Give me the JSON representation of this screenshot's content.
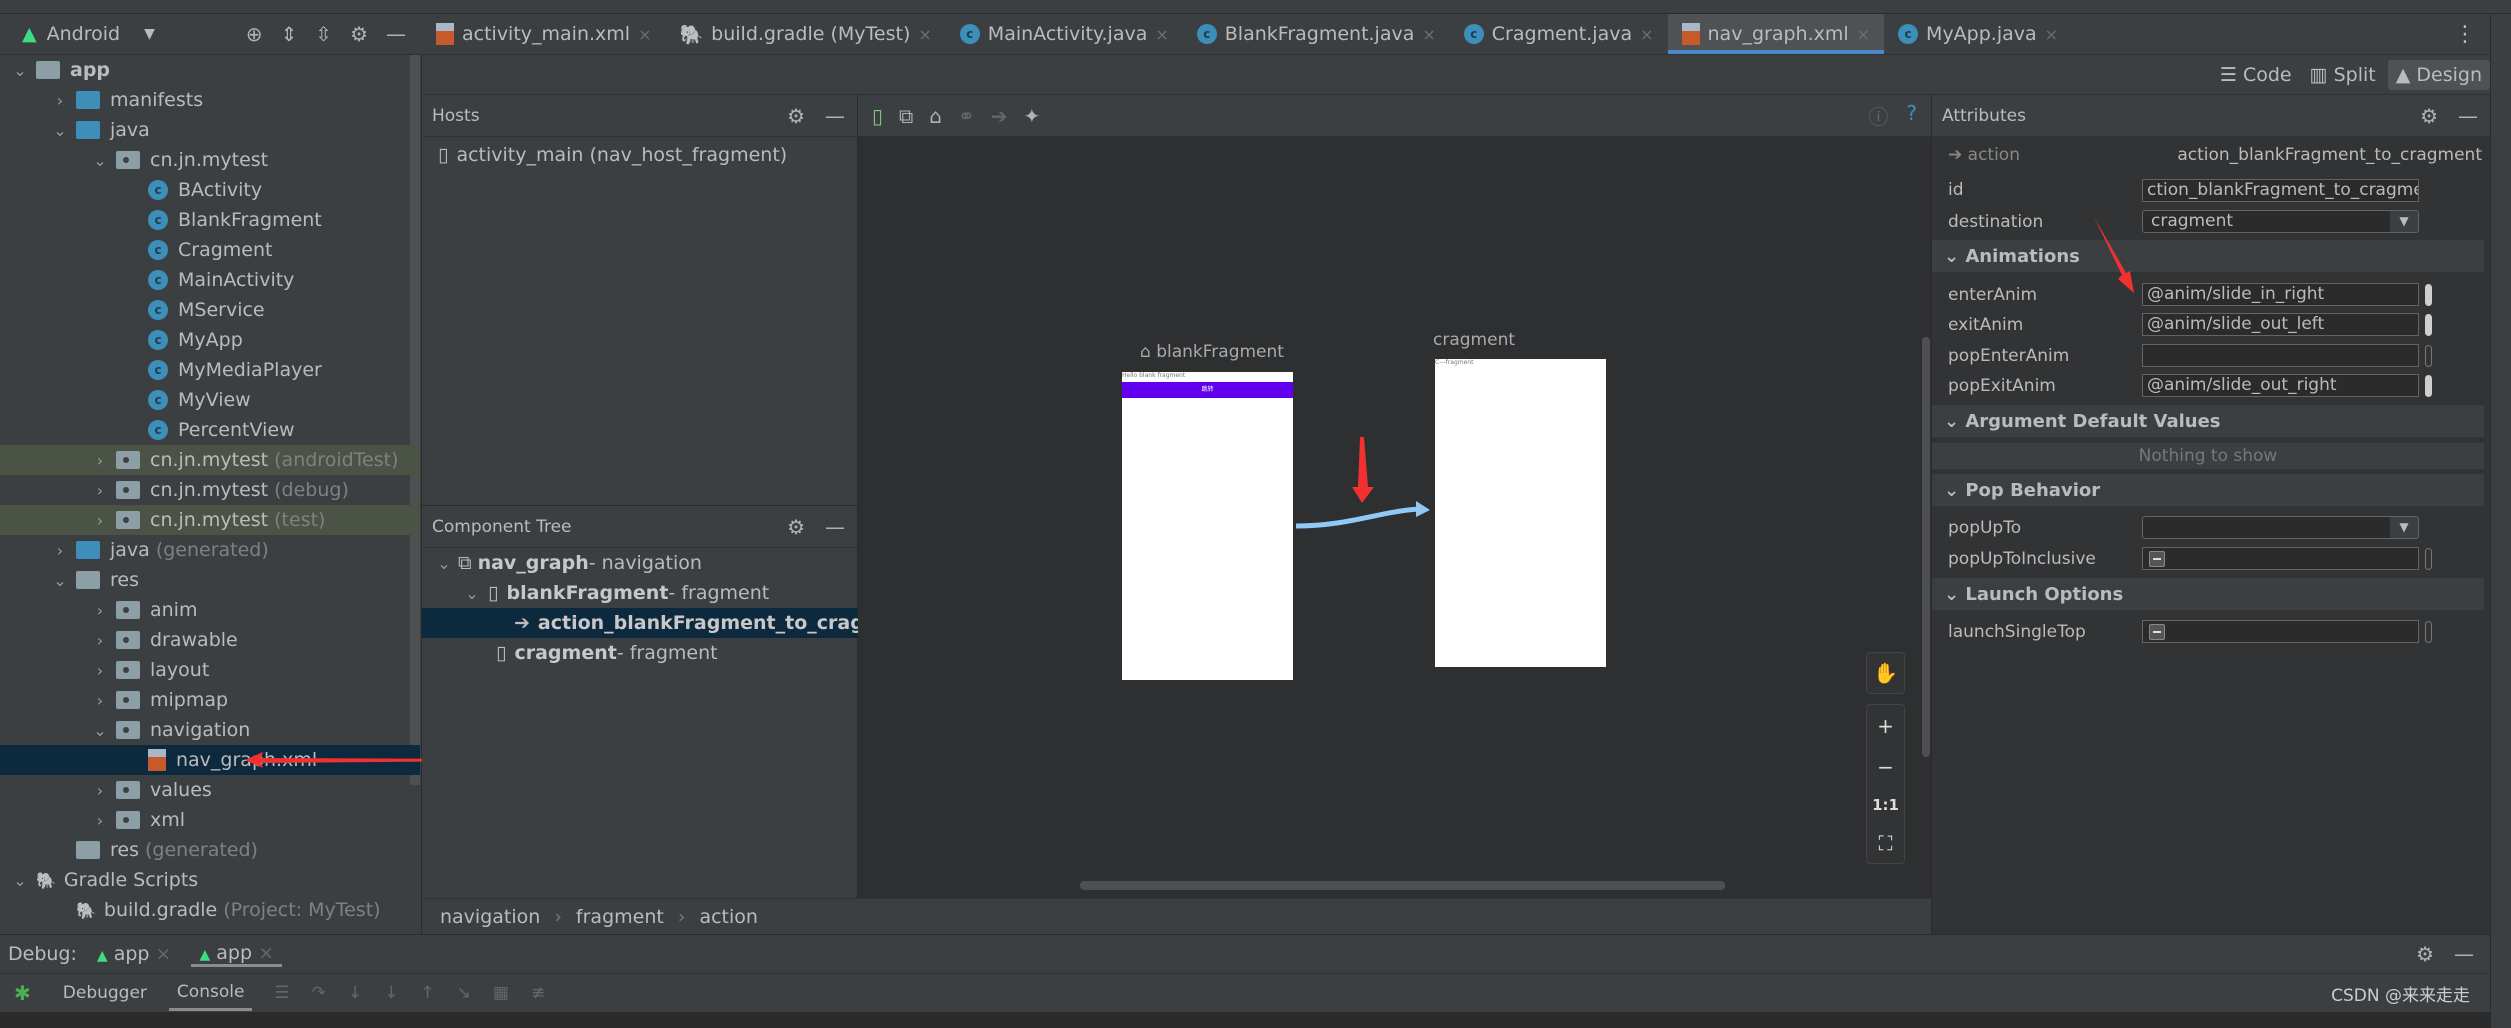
{
  "project": {
    "view": "Android",
    "items": [
      {
        "label": "app",
        "depth": 0,
        "chev": "v",
        "icon": "module",
        "bold": true
      },
      {
        "label": "manifests",
        "depth": 1,
        "chev": ">",
        "icon": "folder-blue"
      },
      {
        "label": "java",
        "depth": 1,
        "chev": "v",
        "icon": "folder-blue"
      },
      {
        "label": "cn.jn.mytest",
        "depth": 2,
        "chev": "v",
        "icon": "package"
      },
      {
        "label": "BActivity",
        "depth": 3,
        "icon": "class"
      },
      {
        "label": "BlankFragment",
        "depth": 3,
        "icon": "class"
      },
      {
        "label": "Cragment",
        "depth": 3,
        "icon": "class"
      },
      {
        "label": "MainActivity",
        "depth": 3,
        "icon": "class"
      },
      {
        "label": "MService",
        "depth": 3,
        "icon": "class"
      },
      {
        "label": "MyApp",
        "depth": 3,
        "icon": "class"
      },
      {
        "label": "MyMediaPlayer",
        "depth": 3,
        "icon": "class"
      },
      {
        "label": "MyView",
        "depth": 3,
        "icon": "class"
      },
      {
        "label": "PercentView",
        "depth": 3,
        "icon": "class"
      },
      {
        "label": "cn.jn.mytest",
        "suffix": "(androidTest)",
        "depth": 2,
        "chev": ">",
        "icon": "package",
        "hl": true
      },
      {
        "label": "cn.jn.mytest",
        "suffix": "(debug)",
        "depth": 2,
        "chev": ">",
        "icon": "package"
      },
      {
        "label": "cn.jn.mytest",
        "suffix": "(test)",
        "depth": 2,
        "chev": ">",
        "icon": "package",
        "hl": true
      },
      {
        "label": "java",
        "suffix": "(generated)",
        "depth": 1,
        "chev": ">",
        "icon": "folder-blue"
      },
      {
        "label": "res",
        "depth": 1,
        "chev": "v",
        "icon": "folder"
      },
      {
        "label": "anim",
        "depth": 2,
        "chev": ">",
        "icon": "package"
      },
      {
        "label": "drawable",
        "depth": 2,
        "chev": ">",
        "icon": "package"
      },
      {
        "label": "layout",
        "depth": 2,
        "chev": ">",
        "icon": "package"
      },
      {
        "label": "mipmap",
        "depth": 2,
        "chev": ">",
        "icon": "package"
      },
      {
        "label": "navigation",
        "depth": 2,
        "chev": "v",
        "icon": "package"
      },
      {
        "label": "nav_graph.xml",
        "depth": 3,
        "icon": "xml",
        "sel": true
      },
      {
        "label": "values",
        "depth": 2,
        "chev": ">",
        "icon": "package"
      },
      {
        "label": "xml",
        "depth": 2,
        "chev": ">",
        "icon": "package"
      },
      {
        "label": "res",
        "suffix": "(generated)",
        "depth": 1,
        "icon": "folder"
      },
      {
        "label": "Gradle Scripts",
        "depth": 0,
        "chev": "v",
        "icon": "gradle"
      },
      {
        "label": "build.gradle",
        "suffix": "(Project: MyTest)",
        "depth": 1,
        "icon": "gradle"
      }
    ]
  },
  "tabs": [
    {
      "label": "activity_main.xml",
      "icon": "xml"
    },
    {
      "label": "build.gradle (MyTest)",
      "icon": "gradle"
    },
    {
      "label": "MainActivity.java",
      "icon": "class"
    },
    {
      "label": "BlankFragment.java",
      "icon": "class"
    },
    {
      "label": "Cragment.java",
      "icon": "class"
    },
    {
      "label": "nav_graph.xml",
      "icon": "xml",
      "active": true
    },
    {
      "label": "MyApp.java",
      "icon": "class"
    }
  ],
  "view_modes": {
    "code": "Code",
    "split": "Split",
    "design": "Design"
  },
  "hosts": {
    "title": "Hosts",
    "item": "activity_main (nav_host_fragment)"
  },
  "component_tree": {
    "title": "Component Tree",
    "rows": [
      {
        "name": "nav_graph",
        "type": " - navigation"
      },
      {
        "name": "blankFragment",
        "type": " - fragment"
      },
      {
        "name": "action_blankFragment_to_cragment",
        "type": ""
      },
      {
        "name": "cragment",
        "type": " - fragment"
      }
    ]
  },
  "canvas": {
    "start": {
      "label": "blankFragment",
      "text": "Hello blank fragment",
      "button": "跳转"
    },
    "dest": {
      "label": "cragment",
      "text": "C---fragment"
    },
    "zoom": {
      "fit": "1:1"
    },
    "accent": "#6200ee",
    "action_color": "#90c8f6"
  },
  "breadcrumb": [
    "navigation",
    "fragment",
    "action"
  ],
  "attributes": {
    "title": "Attributes",
    "type": "action",
    "name": "action_blankFragment_to_cragment",
    "id_label": "id",
    "id_value": "ction_blankFragment_to_cragment",
    "destination_label": "destination",
    "destination_value": "cragment",
    "animations": "Animations",
    "enter_label": "enterAnim",
    "enter_value": "@anim/slide_in_right",
    "exit_label": "exitAnim",
    "exit_value": "@anim/slide_out_left",
    "popenter_label": "popEnterAnim",
    "popenter_value": "",
    "popexit_label": "popExitAnim",
    "popexit_value": "@anim/slide_out_right",
    "args": "Argument Default Values",
    "nothing": "Nothing to show",
    "pop": "Pop Behavior",
    "popupto_label": "popUpTo",
    "popupto_value": "",
    "popinc_label": "popUpToInclusive",
    "launch": "Launch Options",
    "singletop_label": "launchSingleTop"
  },
  "debug": {
    "label": "Debug:",
    "sessions": [
      "app",
      "app"
    ],
    "tabs": [
      "Debugger",
      "Console"
    ]
  },
  "watermark": "CSDN @来来走走"
}
